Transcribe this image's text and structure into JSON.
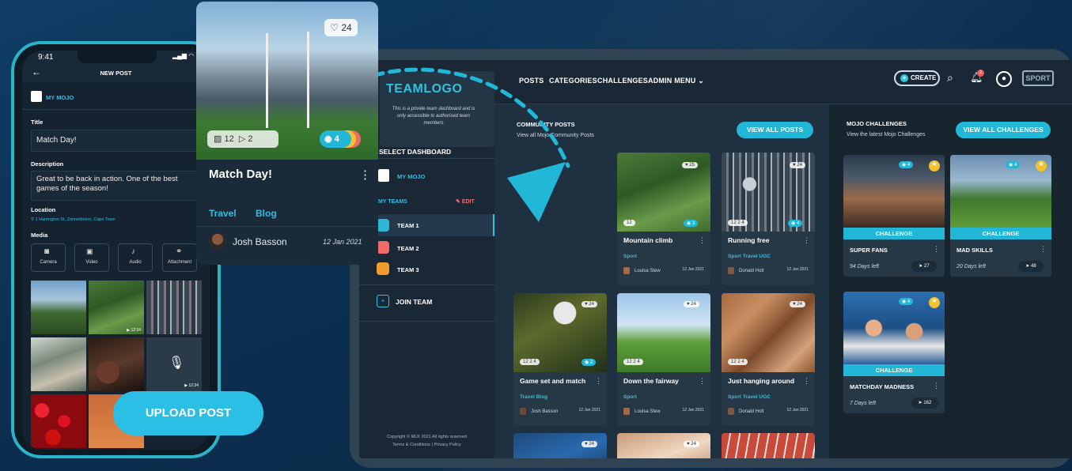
{
  "tablet": {
    "logo": "TEAMLOGO",
    "logo_note": "This is a private team dashboard and is only accessible to authorised team members",
    "select_dashboard": "SELECT DASHBOARD",
    "my_mojo": "MY MOJO",
    "my_teams": "MY TEAMS",
    "edit": "EDIT",
    "teams": [
      "TEAM 1",
      "TEAM 2",
      "TEAM 3"
    ],
    "join_team": "JOIN TEAM",
    "footer1": "Copyright © MLK 2021 All rights reserved",
    "footer2": "Terms & Conditions | Privacy Policy",
    "nav": [
      "POSTS",
      "CATEGORIES",
      "CHALLENGES",
      "ADMIN MENU"
    ],
    "create": "CREATE",
    "sport_logo": "SPORT",
    "community_title": "COMMUNITY POSTS",
    "community_sub": "View all Mojo Community Posts",
    "view_all_posts": "VIEW ALL POSTS",
    "challenges_title": "MOJO CHALLENGES",
    "challenges_sub": "View the latest Mojo Challenges",
    "view_all_challenges": "VIEW ALL CHALLENGES",
    "posts": [
      {
        "title": "Mountain climb",
        "tags": "Sport",
        "author": "Louisa Stew",
        "date": "12 Jan 2021",
        "likes": "25",
        "views": "3",
        "media": "12"
      },
      {
        "title": "Running free",
        "tags": "Sport   Travel   UGC",
        "author": "Donald Holt",
        "date": "12 Jan 2021",
        "likes": "24",
        "views": "4",
        "media": "12  2  4"
      },
      {
        "title": "Game set and match",
        "tags": "Travel   Blog",
        "author": "Josh Basson",
        "date": "12 Jan 2021",
        "likes": "24",
        "views": "2",
        "media": "12  2  4"
      },
      {
        "title": "Down the fairway",
        "tags": "Sport",
        "author": "Louisa Stew",
        "date": "12 Jan 2021",
        "likes": "24",
        "views": "",
        "media": "12  2  4"
      },
      {
        "title": "Just hanging around",
        "tags": "Sport   Travel   UGC",
        "author": "Donald Holt",
        "date": "12 Jan 2021",
        "likes": "24",
        "views": "",
        "media": "12  2  4"
      },
      {
        "likes": "24"
      },
      {
        "likes": "24"
      },
      {
        "likes": ""
      }
    ],
    "challenges": [
      {
        "label": "CHALLENGE",
        "title": "SUPER FANS",
        "days": "94 Days left",
        "count": "27",
        "views": "4"
      },
      {
        "label": "CHALLENGE",
        "title": "MAD SKILLS",
        "days": "20 Days left",
        "count": "48",
        "views": "4"
      },
      {
        "label": "CHALLENGE",
        "title": "MATCHDAY MADNESS",
        "days": "7 Days left",
        "count": "162",
        "views": "4"
      }
    ],
    "notif_count": "2"
  },
  "phone": {
    "time": "9:41",
    "title": "NEW POST",
    "my_mojo": "MY MOJO",
    "title_label": "Title",
    "title_value": "Match Day!",
    "desc_label": "Description",
    "desc_value": "Great to be back in action. One of the best games of the season!",
    "loc_label": "Location",
    "loc_value": "1 Harrington St, Zonnebloem, Cape Town",
    "media_label": "Media",
    "media_buttons": [
      "Camera",
      "Video",
      "Audio",
      "Attachment"
    ],
    "durations": [
      "▶ 12:34",
      "▶ 12:34"
    ]
  },
  "post": {
    "likes": "24",
    "images": "12",
    "videos": "2",
    "views": "4",
    "title": "Match Day!",
    "tags": [
      "Travel",
      "Blog"
    ],
    "author": "Josh Basson",
    "date": "12 Jan 2021"
  },
  "upload": "UPLOAD POST"
}
